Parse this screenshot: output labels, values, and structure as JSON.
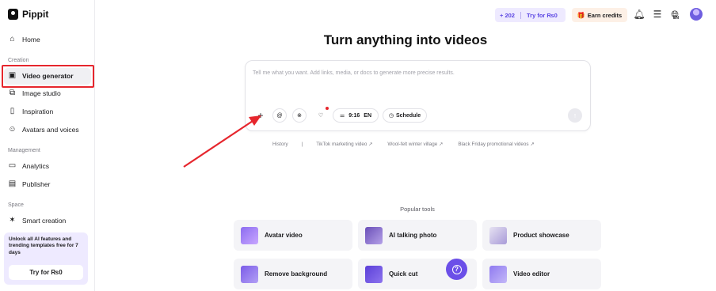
{
  "brand": {
    "name": "Pippit"
  },
  "sidebar": {
    "home": "Home",
    "section_creation": "Creation",
    "creation_items": [
      {
        "label": "Video generator",
        "icon": "video-generator-icon"
      },
      {
        "label": "Image studio",
        "icon": "image-studio-icon"
      },
      {
        "label": "Inspiration",
        "icon": "inspiration-icon"
      },
      {
        "label": "Avatars and voices",
        "icon": "avatars-icon"
      }
    ],
    "section_management": "Management",
    "management_items": [
      {
        "label": "Analytics",
        "icon": "analytics-icon"
      },
      {
        "label": "Publisher",
        "icon": "publisher-icon"
      }
    ],
    "section_space": "Space",
    "space_items": [
      {
        "label": "Smart creation",
        "icon": "smart-creation-icon"
      }
    ],
    "promo": {
      "text": "Unlock all AI features and trending templates free for 7 days",
      "button": "Try for ₨0"
    }
  },
  "topbar": {
    "credits": "+ 202",
    "try_label": "Try for ₨0",
    "earn_label": "Earn credits",
    "lang": "EN"
  },
  "main": {
    "headline": "Turn anything into videos",
    "prompt_placeholder": "Tell me what you want. Add links, media, or docs to generate more precise results.",
    "ratio": "9:16",
    "language": "EN",
    "schedule": "Schedule",
    "suggestions": [
      "History",
      "|",
      "TikTok marketing video ↗",
      "Wool-felt winter village ↗",
      "Black Friday promotional videos ↗"
    ],
    "popular_title": "Popular tools",
    "tools": [
      {
        "label": "Avatar video",
        "color": "#8b6cf0"
      },
      {
        "label": "AI talking photo",
        "color": "#6a4fb8"
      },
      {
        "label": "Product showcase",
        "color": "#d8d4e8"
      },
      {
        "label": "Remove background",
        "color": "#7b5ce8"
      },
      {
        "label": "Quick cut",
        "color": "#5b3fd8"
      },
      {
        "label": "Video editor",
        "color": "#8f7af0"
      }
    ]
  },
  "colors": {
    "accent": "#5b46e3",
    "highlight": "#e6262d",
    "promo_bg": "#eeeaff"
  }
}
